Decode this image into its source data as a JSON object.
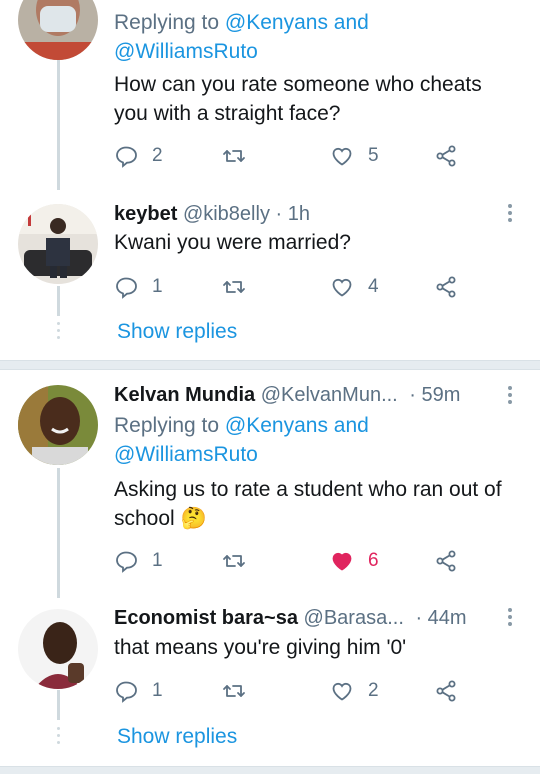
{
  "tweets": [
    {
      "reply_prefix": "Replying to",
      "reply_mentions": "@Kenyans and",
      "reply_mentions2": "@WilliamsRuto",
      "text": "How can you rate someone who  cheats you with a straight face?",
      "replies": "2",
      "likes": "5",
      "liked": false
    },
    {
      "name": "keybet",
      "handle": "@kib8elly",
      "time": "· 1h",
      "text": "Kwani you were married?",
      "replies": "1",
      "likes": "4",
      "liked": false
    },
    {
      "name": "Kelvan Mundia",
      "handle": "@KelvanMun...",
      "time": "· 59m",
      "reply_prefix": "Replying to",
      "reply_mentions": "@Kenyans and",
      "reply_mentions2": "@WilliamsRuto",
      "text": "Asking us to rate a student who ran out of school",
      "emoji": "🤔",
      "replies": "1",
      "likes": "6",
      "liked": true
    },
    {
      "name": "Economist bara~sa",
      "handle": "@Barasa...",
      "time": "· 44m",
      "text": "that means you're giving him '0'",
      "replies": "1",
      "likes": "2",
      "liked": false
    }
  ],
  "show_replies_label": "Show replies",
  "colors": {
    "link": "#1b95e0",
    "secondary": "#5b7083",
    "like_active": "#e0245e",
    "thread_line": "#cfd9de"
  },
  "icons": [
    "reply-icon",
    "retweet-icon",
    "like-icon",
    "share-icon",
    "more-options-icon"
  ]
}
